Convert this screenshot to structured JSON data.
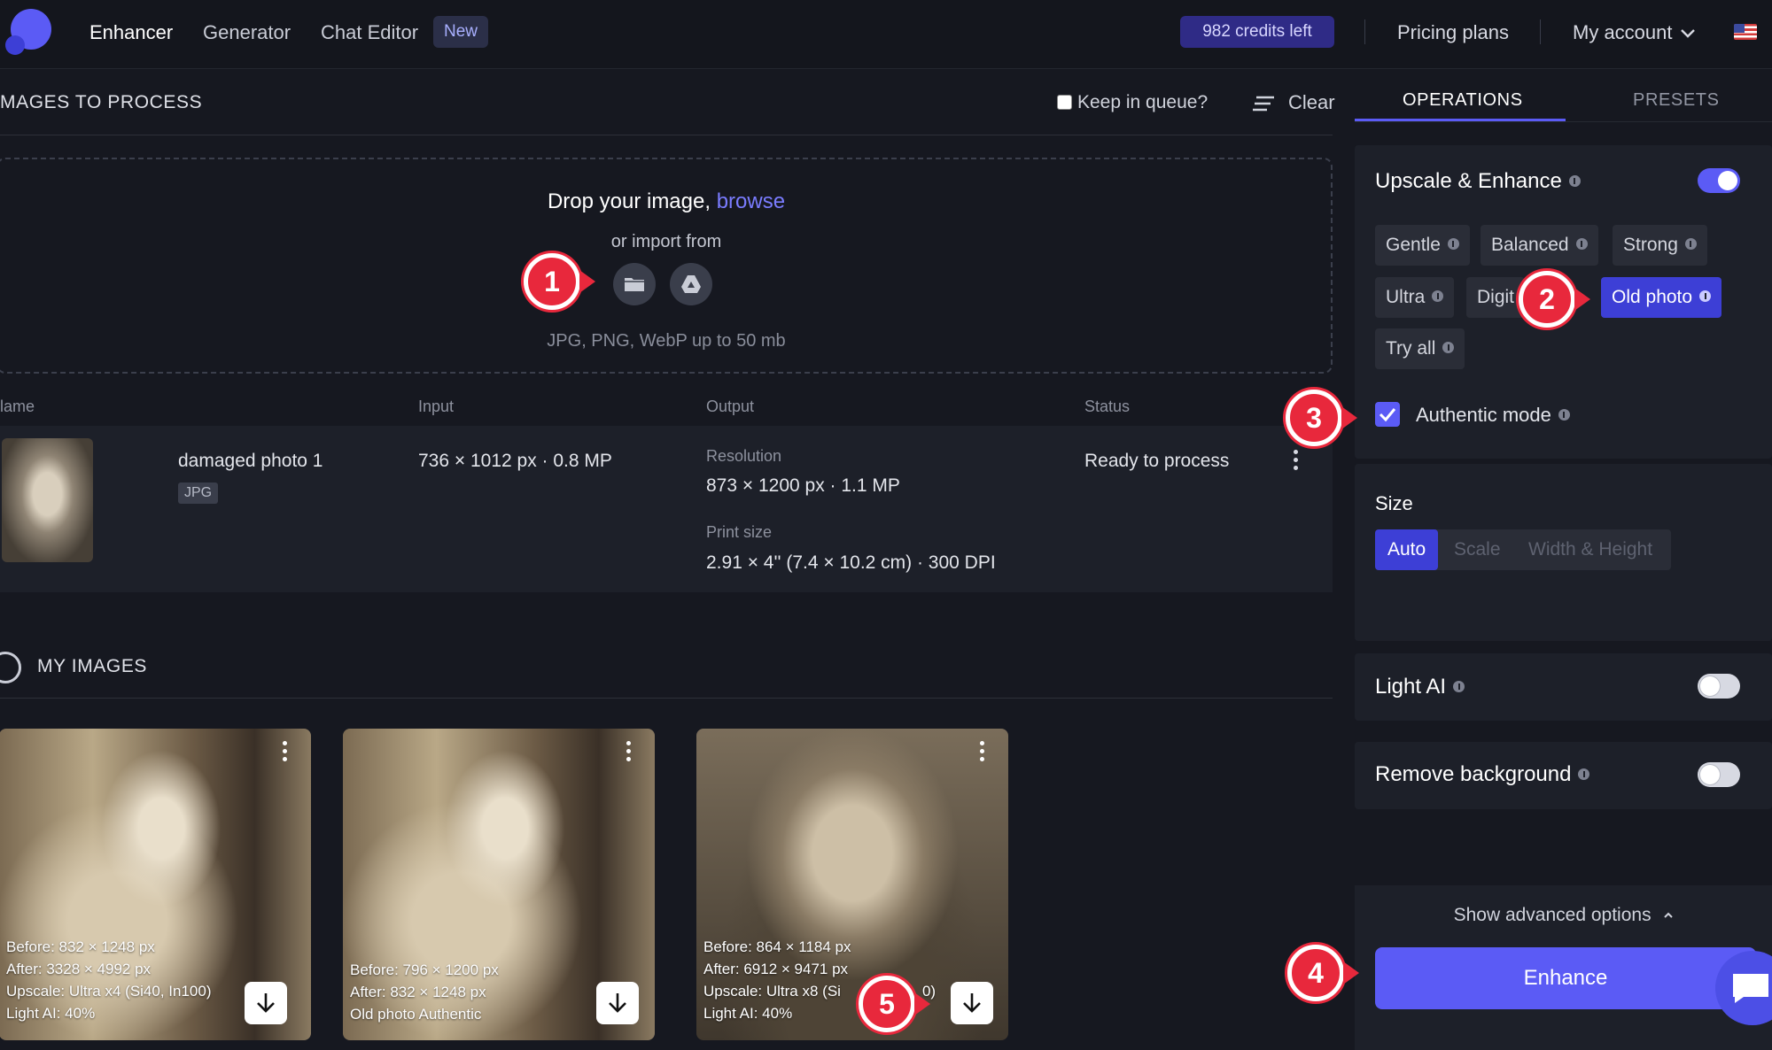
{
  "nav": {
    "items": [
      {
        "label": "Enhancer"
      },
      {
        "label": "Generator"
      },
      {
        "label": "Chat Editor"
      }
    ],
    "new_badge": "New",
    "credits": "982 credits left",
    "pricing": "Pricing plans",
    "account": "My account"
  },
  "queue": {
    "title": "MAGES TO PROCESS",
    "keep_label": "Keep in queue?",
    "clear_label": "Clear"
  },
  "dropzone": {
    "title": "Drop your image,",
    "browse": "browse",
    "import_text": "or import from",
    "types": "JPG, PNG, WebP up to 50 mb",
    "import_icons": [
      "folder-icon",
      "google-drive-icon"
    ]
  },
  "table": {
    "headers": {
      "name": "lame",
      "input": "Input",
      "output": "Output",
      "status": "Status"
    },
    "row": {
      "name": "damaged photo 1",
      "format": "JPG",
      "input": "736 × 1012 px · 0.8 MP",
      "resolution_label": "Resolution",
      "resolution": "873 × 1200 px · 1.1 MP",
      "print_label": "Print size",
      "print": "2.91 × 4'' (7.4 × 10.2 cm) · 300 DPI",
      "status": "Ready to process"
    }
  },
  "my_images": {
    "title": "MY IMAGES",
    "cards": [
      {
        "lines": [
          "Before: 832 × 1248 px",
          "After:    3328 × 4992 px",
          "Upscale: Ultra x4 (Si40, In100)",
          "Light AI: 40%"
        ]
      },
      {
        "lines": [
          "Before: 796 × 1200 px",
          "After:    832 × 1248 px",
          "Old photo Authentic"
        ]
      },
      {
        "lines": [
          "Before: 864 × 1184 px",
          "After:    6912 × 9471 px",
          "Upscale: Ultra x8 (Si",
          "Light AI: 40%"
        ],
        "line3_tail": "0)"
      }
    ]
  },
  "panel": {
    "tabs": {
      "operations": "OPERATIONS",
      "presets": "PRESETS"
    },
    "upscale": {
      "title": "Upscale & Enhance",
      "enabled": true,
      "options": [
        "Gentle",
        "Balanced",
        "Strong",
        "Ultra",
        "Digit",
        "Old photo",
        "Try all"
      ],
      "selected": "Old photo"
    },
    "authentic": {
      "label": "Authentic mode",
      "checked": true
    },
    "size": {
      "label": "Size",
      "options": [
        "Auto",
        "Scale",
        "Width & Height"
      ],
      "selected": "Auto"
    },
    "light_ai": {
      "title": "Light AI",
      "enabled": false
    },
    "remove_bg": {
      "title": "Remove background",
      "enabled": false
    },
    "advanced": "Show advanced options",
    "enhance": "Enhance"
  },
  "markers": [
    "1",
    "2",
    "3",
    "4",
    "5"
  ],
  "colors": {
    "accent": "#5b5bf5",
    "selected_chip": "#3d3fd6",
    "marker": "#e8283c",
    "credits_bg": "#2f2b86"
  }
}
